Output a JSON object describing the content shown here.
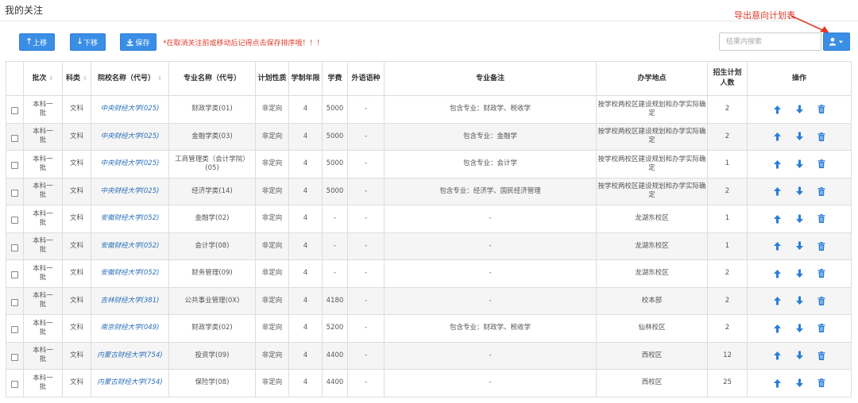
{
  "page": {
    "title": "我的关注"
  },
  "annotation": {
    "text": "导出意向计划表",
    "color": "#e0392b"
  },
  "toolbar": {
    "up_label": "上移",
    "down_label": "下移",
    "save_label": "保存",
    "notice": "*在取消关注前或移动后记得点击保存排序哦！！！",
    "search_placeholder": "结果内搜索",
    "export_icon": "user-export-icon"
  },
  "colors": {
    "primary": "#3a8ee6",
    "warning_text": "#e0392b",
    "link": "#2a6fb8"
  },
  "table": {
    "headers": {
      "batch": "批次",
      "category": "科类",
      "school": "院校名称（代号）",
      "major": "专业名称（代号）",
      "nature": "计划性质",
      "years": "学制年限",
      "fee": "学费",
      "language": "外语语种",
      "remark": "专业备注",
      "location": "办学地点",
      "plan_line1": "招生计划",
      "plan_line2": "人数",
      "ops": "操作"
    },
    "rows": [
      {
        "batch_a": "本科一",
        "batch_b": "批",
        "category": "文科",
        "school": "中央财经大学(025)",
        "major": "财政学类(01)",
        "nature": "非定向",
        "years": "4",
        "fee": "5000",
        "language": "-",
        "remark": "包含专业：财政学、税收学",
        "location": "按学校两校区建设规划和办学实际确定",
        "plan": "2"
      },
      {
        "batch_a": "本科一",
        "batch_b": "批",
        "category": "文科",
        "school": "中央财经大学(025)",
        "major": "金融学类(03)",
        "nature": "非定向",
        "years": "4",
        "fee": "5000",
        "language": "-",
        "remark": "包含专业：金融学",
        "location": "按学校两校区建设规划和办学实际确定",
        "plan": "2"
      },
      {
        "batch_a": "本科一",
        "batch_b": "批",
        "category": "文科",
        "school": "中央财经大学(025)",
        "major": "工商管理类（会计学院）(05)",
        "nature": "非定向",
        "years": "4",
        "fee": "5000",
        "language": "-",
        "remark": "包含专业：会计学",
        "location": "按学校两校区建设规划和办学实际确定",
        "plan": "1"
      },
      {
        "batch_a": "本科一",
        "batch_b": "批",
        "category": "文科",
        "school": "中央财经大学(025)",
        "major": "经济学类(14)",
        "nature": "非定向",
        "years": "4",
        "fee": "5000",
        "language": "-",
        "remark": "包含专业：经济学、国民经济管理",
        "location": "按学校两校区建设规划和办学实际确定",
        "plan": "2"
      },
      {
        "batch_a": "本科一",
        "batch_b": "批",
        "category": "文科",
        "school": "安徽财经大学(052)",
        "major": "金融学(02)",
        "nature": "非定向",
        "years": "4",
        "fee": "-",
        "language": "-",
        "remark": "-",
        "location": "龙湖东校区",
        "plan": "1"
      },
      {
        "batch_a": "本科一",
        "batch_b": "批",
        "category": "文科",
        "school": "安徽财经大学(052)",
        "major": "会计学(08)",
        "nature": "非定向",
        "years": "4",
        "fee": "-",
        "language": "-",
        "remark": "-",
        "location": "龙湖东校区",
        "plan": "1"
      },
      {
        "batch_a": "本科一",
        "batch_b": "批",
        "category": "文科",
        "school": "安徽财经大学(052)",
        "major": "财务管理(09)",
        "nature": "非定向",
        "years": "4",
        "fee": "-",
        "language": "-",
        "remark": "-",
        "location": "龙湖东校区",
        "plan": "2"
      },
      {
        "batch_a": "本科一",
        "batch_b": "批",
        "category": "文科",
        "school": "吉林财经大学(381)",
        "major": "公共事业管理(0X)",
        "nature": "非定向",
        "years": "4",
        "fee": "4180",
        "language": "-",
        "remark": "-",
        "location": "校本部",
        "plan": "2"
      },
      {
        "batch_a": "本科一",
        "batch_b": "批",
        "category": "文科",
        "school": "南京财经大学(049)",
        "major": "财政学类(02)",
        "nature": "非定向",
        "years": "4",
        "fee": "5200",
        "language": "-",
        "remark": "包含专业：财政学、税收学",
        "location": "仙林校区",
        "plan": "2"
      },
      {
        "batch_a": "本科一",
        "batch_b": "批",
        "category": "文科",
        "school": "内蒙古财经大学(754)",
        "major": "投资学(09)",
        "nature": "非定向",
        "years": "4",
        "fee": "4400",
        "language": "-",
        "remark": "-",
        "location": "西校区",
        "plan": "12"
      },
      {
        "batch_a": "本科一",
        "batch_b": "批",
        "category": "文科",
        "school": "内蒙古财经大学(754)",
        "major": "保险学(08)",
        "nature": "非定向",
        "years": "4",
        "fee": "4400",
        "language": "-",
        "remark": "-",
        "location": "西校区",
        "plan": "25"
      }
    ]
  }
}
